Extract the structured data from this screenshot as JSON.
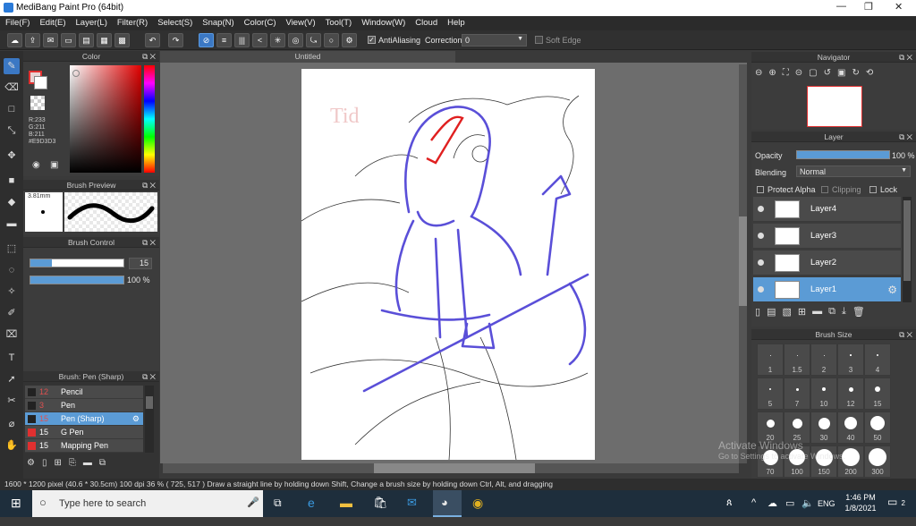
{
  "app": {
    "title": "MediBang Paint Pro (64bit)"
  },
  "menu": [
    "File(F)",
    "Edit(E)",
    "Layer(L)",
    "Filter(R)",
    "Select(S)",
    "Snap(N)",
    "Color(C)",
    "View(V)",
    "Tool(T)",
    "Window(W)",
    "Cloud",
    "Help"
  ],
  "toolbar": {
    "antialiasing_label": "AntiAliasing",
    "correction_label": "Correction",
    "correction_value": "0",
    "soft_edge_label": "Soft Edge"
  },
  "document": {
    "tab": "Untitled"
  },
  "color_panel": {
    "title": "Color",
    "r": "R:233",
    "g": "G:211",
    "b": "B:211",
    "hex": "#E9D3D3"
  },
  "brush_preview": {
    "title": "Brush Preview",
    "size": "3.81mm"
  },
  "brush_control": {
    "title": "Brush Control",
    "size": "15",
    "opacity": "100 %",
    "size_fraction": 0.23,
    "opacity_fraction": 1.0
  },
  "brush_list": {
    "title": "Brush: Pen (Sharp)",
    "items": [
      {
        "size": "12",
        "name": "Pencil",
        "color": "#222222"
      },
      {
        "size": "3",
        "name": "Pen",
        "color": "#222222"
      },
      {
        "size": "15",
        "name": "Pen (Sharp)",
        "color": "#222222",
        "selected": true
      },
      {
        "size": "15",
        "name": "G Pen",
        "color": "#e03030"
      },
      {
        "size": "15",
        "name": "Mapping Pen",
        "color": "#e03030"
      }
    ]
  },
  "navigator": {
    "title": "Navigator"
  },
  "layer_panel": {
    "title": "Layer",
    "opacity_label": "Opacity",
    "opacity_value": "100 %",
    "blending_label": "Blending",
    "blending_value": "Normal",
    "protect_alpha": "Protect Alpha",
    "clipping": "Clipping",
    "lock": "Lock",
    "layers": [
      {
        "name": "Layer4"
      },
      {
        "name": "Layer3"
      },
      {
        "name": "Layer2"
      },
      {
        "name": "Layer1",
        "selected": true
      }
    ]
  },
  "brush_size": {
    "title": "Brush Size",
    "sizes": [
      "1",
      "1.5",
      "2",
      "3",
      "4",
      "5",
      "7",
      "10",
      "12",
      "15",
      "20",
      "25",
      "30",
      "40",
      "50",
      "70",
      "100",
      "150",
      "200",
      "300"
    ]
  },
  "status": {
    "dimensions": "1600 * 1200 pixel",
    "physical": "(40.6 * 30.5cm)",
    "dpi": "100 dpi",
    "zoom": "36 %",
    "coords": "( 725, 517 )",
    "hint": "Draw a straight line by holding down Shift, Change a brush size by holding down Ctrl, Alt, and dragging"
  },
  "watermark": {
    "line1": "Activate Windows",
    "line2": "Go to Settings to activate Windows."
  },
  "taskbar": {
    "search_placeholder": "Type here to search",
    "lang": "ENG",
    "time": "1:46 PM",
    "date": "1/8/2021",
    "notif": "2"
  }
}
